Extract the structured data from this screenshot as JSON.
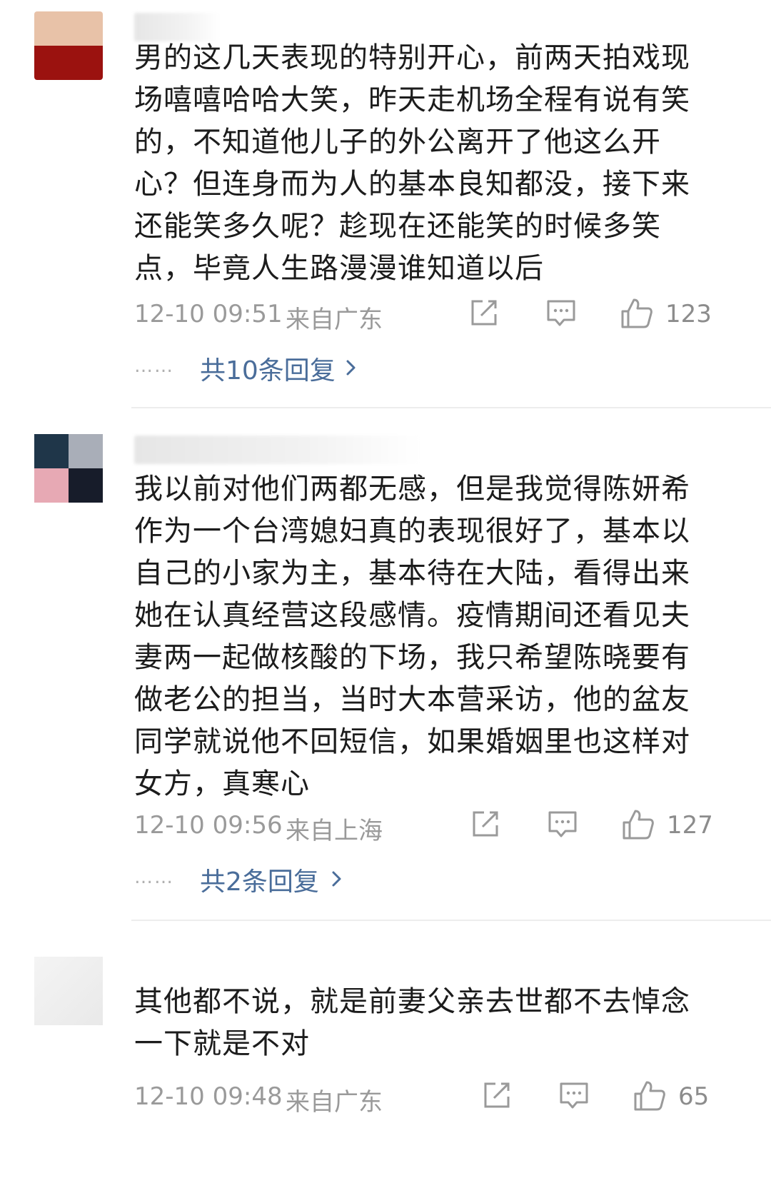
{
  "comments": [
    {
      "lines": [
        "男的这几天表现的特别开心，前两天拍戏现",
        "场嘻嘻哈哈大笑，昨天走机场全程有说有笑",
        "的，不知道他儿子的外公离开了他这么开",
        "心？但连身而为人的基本良知都没，接下来",
        "还能笑多久呢？趁现在还能笑的时候多笑",
        "点，毕竟人生路漫漫谁知道以后"
      ],
      "time": "12-10 09:51",
      "location": "来自广东",
      "likes": "123",
      "replies": "共10条回复",
      "dots": "……"
    },
    {
      "lines": [
        "我以前对他们两都无感，但是我觉得陈妍希",
        "作为一个台湾媳妇真的表现很好了，基本以",
        "自己的小家为主，基本待在大陆，看得出来",
        "她在认真经营这段感情。疫情期间还看见夫",
        "妻两一起做核酸的下场，我只希望陈晓要有",
        "做老公的担当，当时大本营采访，他的盆友",
        "同学就说他不回短信，如果婚姻里也这样对",
        "女方，真寒心"
      ],
      "time": "12-10 09:56",
      "location": "来自上海",
      "likes": "127",
      "replies": "共2条回复",
      "dots": "……"
    },
    {
      "lines": [
        "其他都不说，就是前妻父亲去世都不去悼念",
        "一下就是不对"
      ],
      "time": "12-10 09:48",
      "location": "来自广东",
      "likes": "65"
    }
  ],
  "colors": {
    "text": "#1c1c1c",
    "meta": "#9a9a9a",
    "reply_link": "#4a6d9a",
    "divider": "#ededed"
  },
  "icons": [
    "share-icon",
    "comment-icon",
    "like-icon",
    "chevron-right-icon"
  ]
}
